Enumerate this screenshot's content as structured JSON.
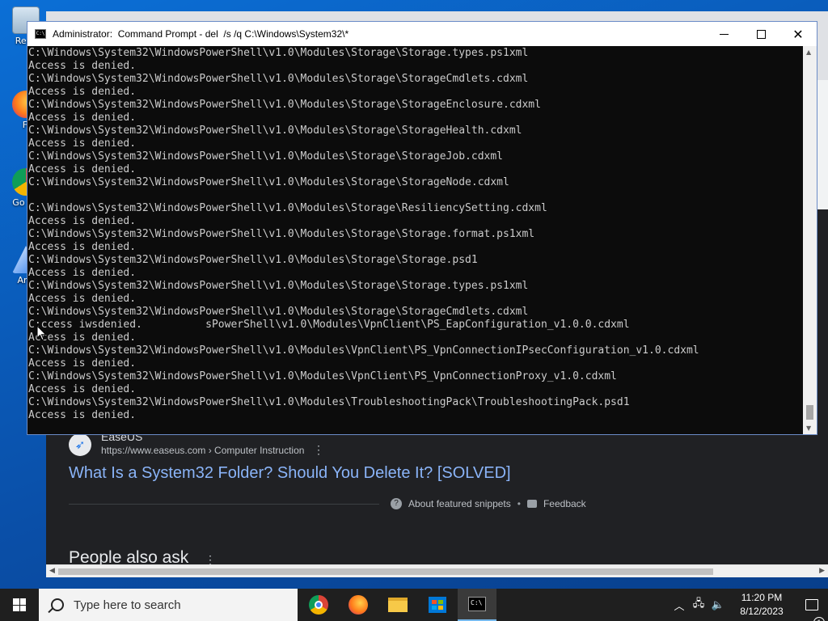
{
  "desktop": {
    "icons": [
      {
        "label": "Recy"
      },
      {
        "label": "Fi"
      },
      {
        "label": "Go Ch"
      },
      {
        "label": "Any"
      }
    ]
  },
  "browser": {
    "result": {
      "site": "EaseUS",
      "url": "https://www.easeus.com › Computer Instruction",
      "more": "⋮",
      "link_title": "What Is a System32 Folder? Should You Delete It? [SOLVED]"
    },
    "about_snippets": "About featured snippets",
    "separator": "•",
    "feedback": "Feedback",
    "people_also_ask": "People also ask",
    "people_more": "⋮"
  },
  "cmd": {
    "title": "Administrator:  Command Prompt - del  /s /q C:\\Windows\\System32\\*",
    "icon_text": "C:\\",
    "lines": [
      "C:\\Windows\\System32\\WindowsPowerShell\\v1.0\\Modules\\Storage\\Storage.types.ps1xml",
      "Access is denied.",
      "C:\\Windows\\System32\\WindowsPowerShell\\v1.0\\Modules\\Storage\\StorageCmdlets.cdxml",
      "Access is denied.",
      "C:\\Windows\\System32\\WindowsPowerShell\\v1.0\\Modules\\Storage\\StorageEnclosure.cdxml",
      "Access is denied.",
      "C:\\Windows\\System32\\WindowsPowerShell\\v1.0\\Modules\\Storage\\StorageHealth.cdxml",
      "Access is denied.",
      "C:\\Windows\\System32\\WindowsPowerShell\\v1.0\\Modules\\Storage\\StorageJob.cdxml",
      "Access is denied.",
      "C:\\Windows\\System32\\WindowsPowerShell\\v1.0\\Modules\\Storage\\StorageNode.cdxml",
      "",
      "C:\\Windows\\System32\\WindowsPowerShell\\v1.0\\Modules\\Storage\\ResiliencySetting.cdxml",
      "Access is denied.",
      "C:\\Windows\\System32\\WindowsPowerShell\\v1.0\\Modules\\Storage\\Storage.format.ps1xml",
      "Access is denied.",
      "C:\\Windows\\System32\\WindowsPowerShell\\v1.0\\Modules\\Storage\\Storage.psd1",
      "Access is denied.",
      "C:\\Windows\\System32\\WindowsPowerShell\\v1.0\\Modules\\Storage\\Storage.types.ps1xml",
      "Access is denied.",
      "C:\\Windows\\System32\\WindowsPowerShell\\v1.0\\Modules\\Storage\\StorageCmdlets.cdxml",
      "C:ccess iwsdenied.          sPowerShell\\v1.0\\Modules\\VpnClient\\PS_EapConfiguration_v1.0.0.cdxml",
      "Access is denied.",
      "C:\\Windows\\System32\\WindowsPowerShell\\v1.0\\Modules\\VpnClient\\PS_VpnConnectionIPsecConfiguration_v1.0.cdxml",
      "Access is denied.",
      "C:\\Windows\\System32\\WindowsPowerShell\\v1.0\\Modules\\VpnClient\\PS_VpnConnectionProxy_v1.0.cdxml",
      "Access is denied.",
      "C:\\Windows\\System32\\WindowsPowerShell\\v1.0\\Modules\\TroubleshootingPack\\TroubleshootingPack.psd1",
      "Access is denied."
    ]
  },
  "taskbar": {
    "search_placeholder": "Type here to search",
    "clock_time": "11:20 PM",
    "clock_date": "8/12/2023",
    "notification_count": "1",
    "cmd_icon_text": "C:\\"
  }
}
